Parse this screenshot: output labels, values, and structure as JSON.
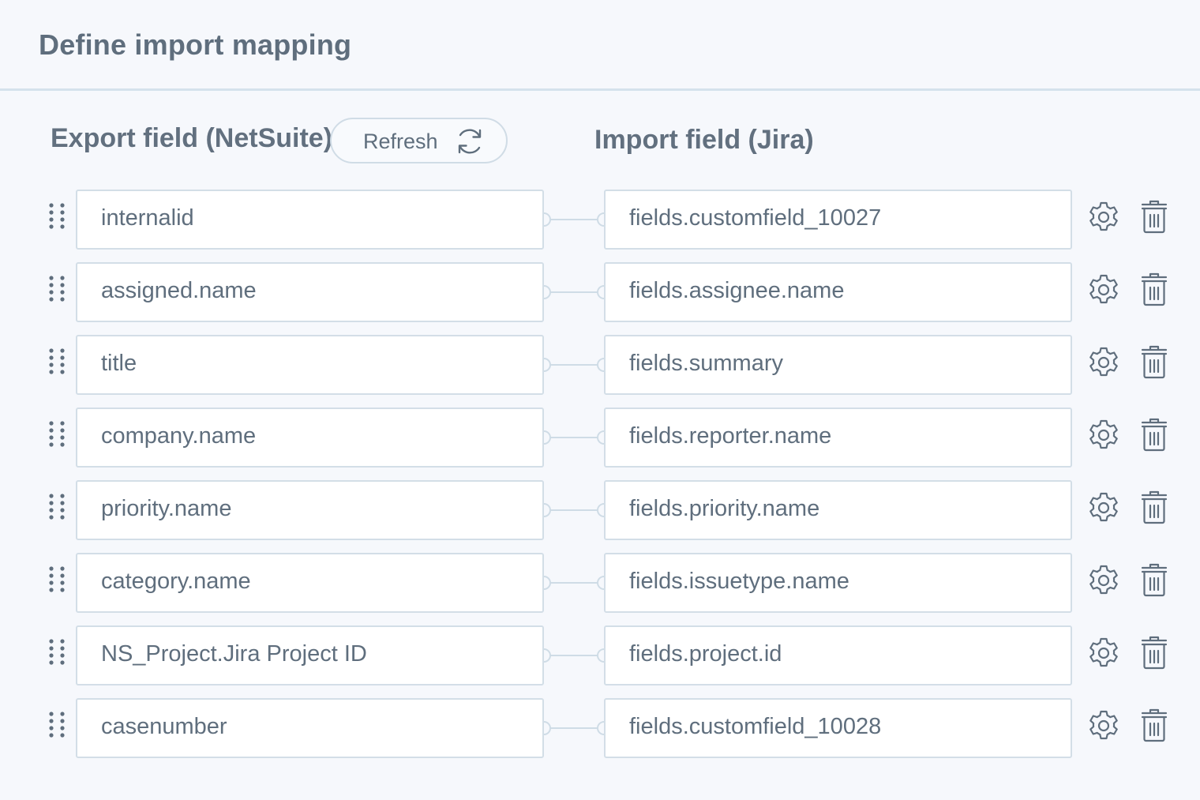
{
  "page": {
    "title": "Define import mapping"
  },
  "columns": {
    "export_title": "Export field (NetSuite)",
    "import_title": "Import field (Jira)",
    "refresh_label": "Refresh"
  },
  "icons": {
    "refresh": "refresh-icon",
    "drag": "drag-handle-icon",
    "settings": "gear-icon",
    "delete": "trash-icon"
  },
  "colors": {
    "background": "#f6f8fc",
    "field_border": "#d3dee7",
    "text": "#5f6e7d",
    "icon": "#5f6e7d",
    "connector": "#cfdce6"
  },
  "mappings": [
    {
      "export": "internalid",
      "import": "fields.customfield_10027"
    },
    {
      "export": "assigned.name",
      "import": "fields.assignee.name"
    },
    {
      "export": "title",
      "import": "fields.summary"
    },
    {
      "export": "company.name",
      "import": "fields.reporter.name"
    },
    {
      "export": "priority.name",
      "import": "fields.priority.name"
    },
    {
      "export": "category.name",
      "import": "fields.issuetype.name"
    },
    {
      "export": "NS_Project.Jira Project ID",
      "import": "fields.project.id"
    },
    {
      "export": "casenumber",
      "import": "fields.customfield_10028"
    }
  ]
}
